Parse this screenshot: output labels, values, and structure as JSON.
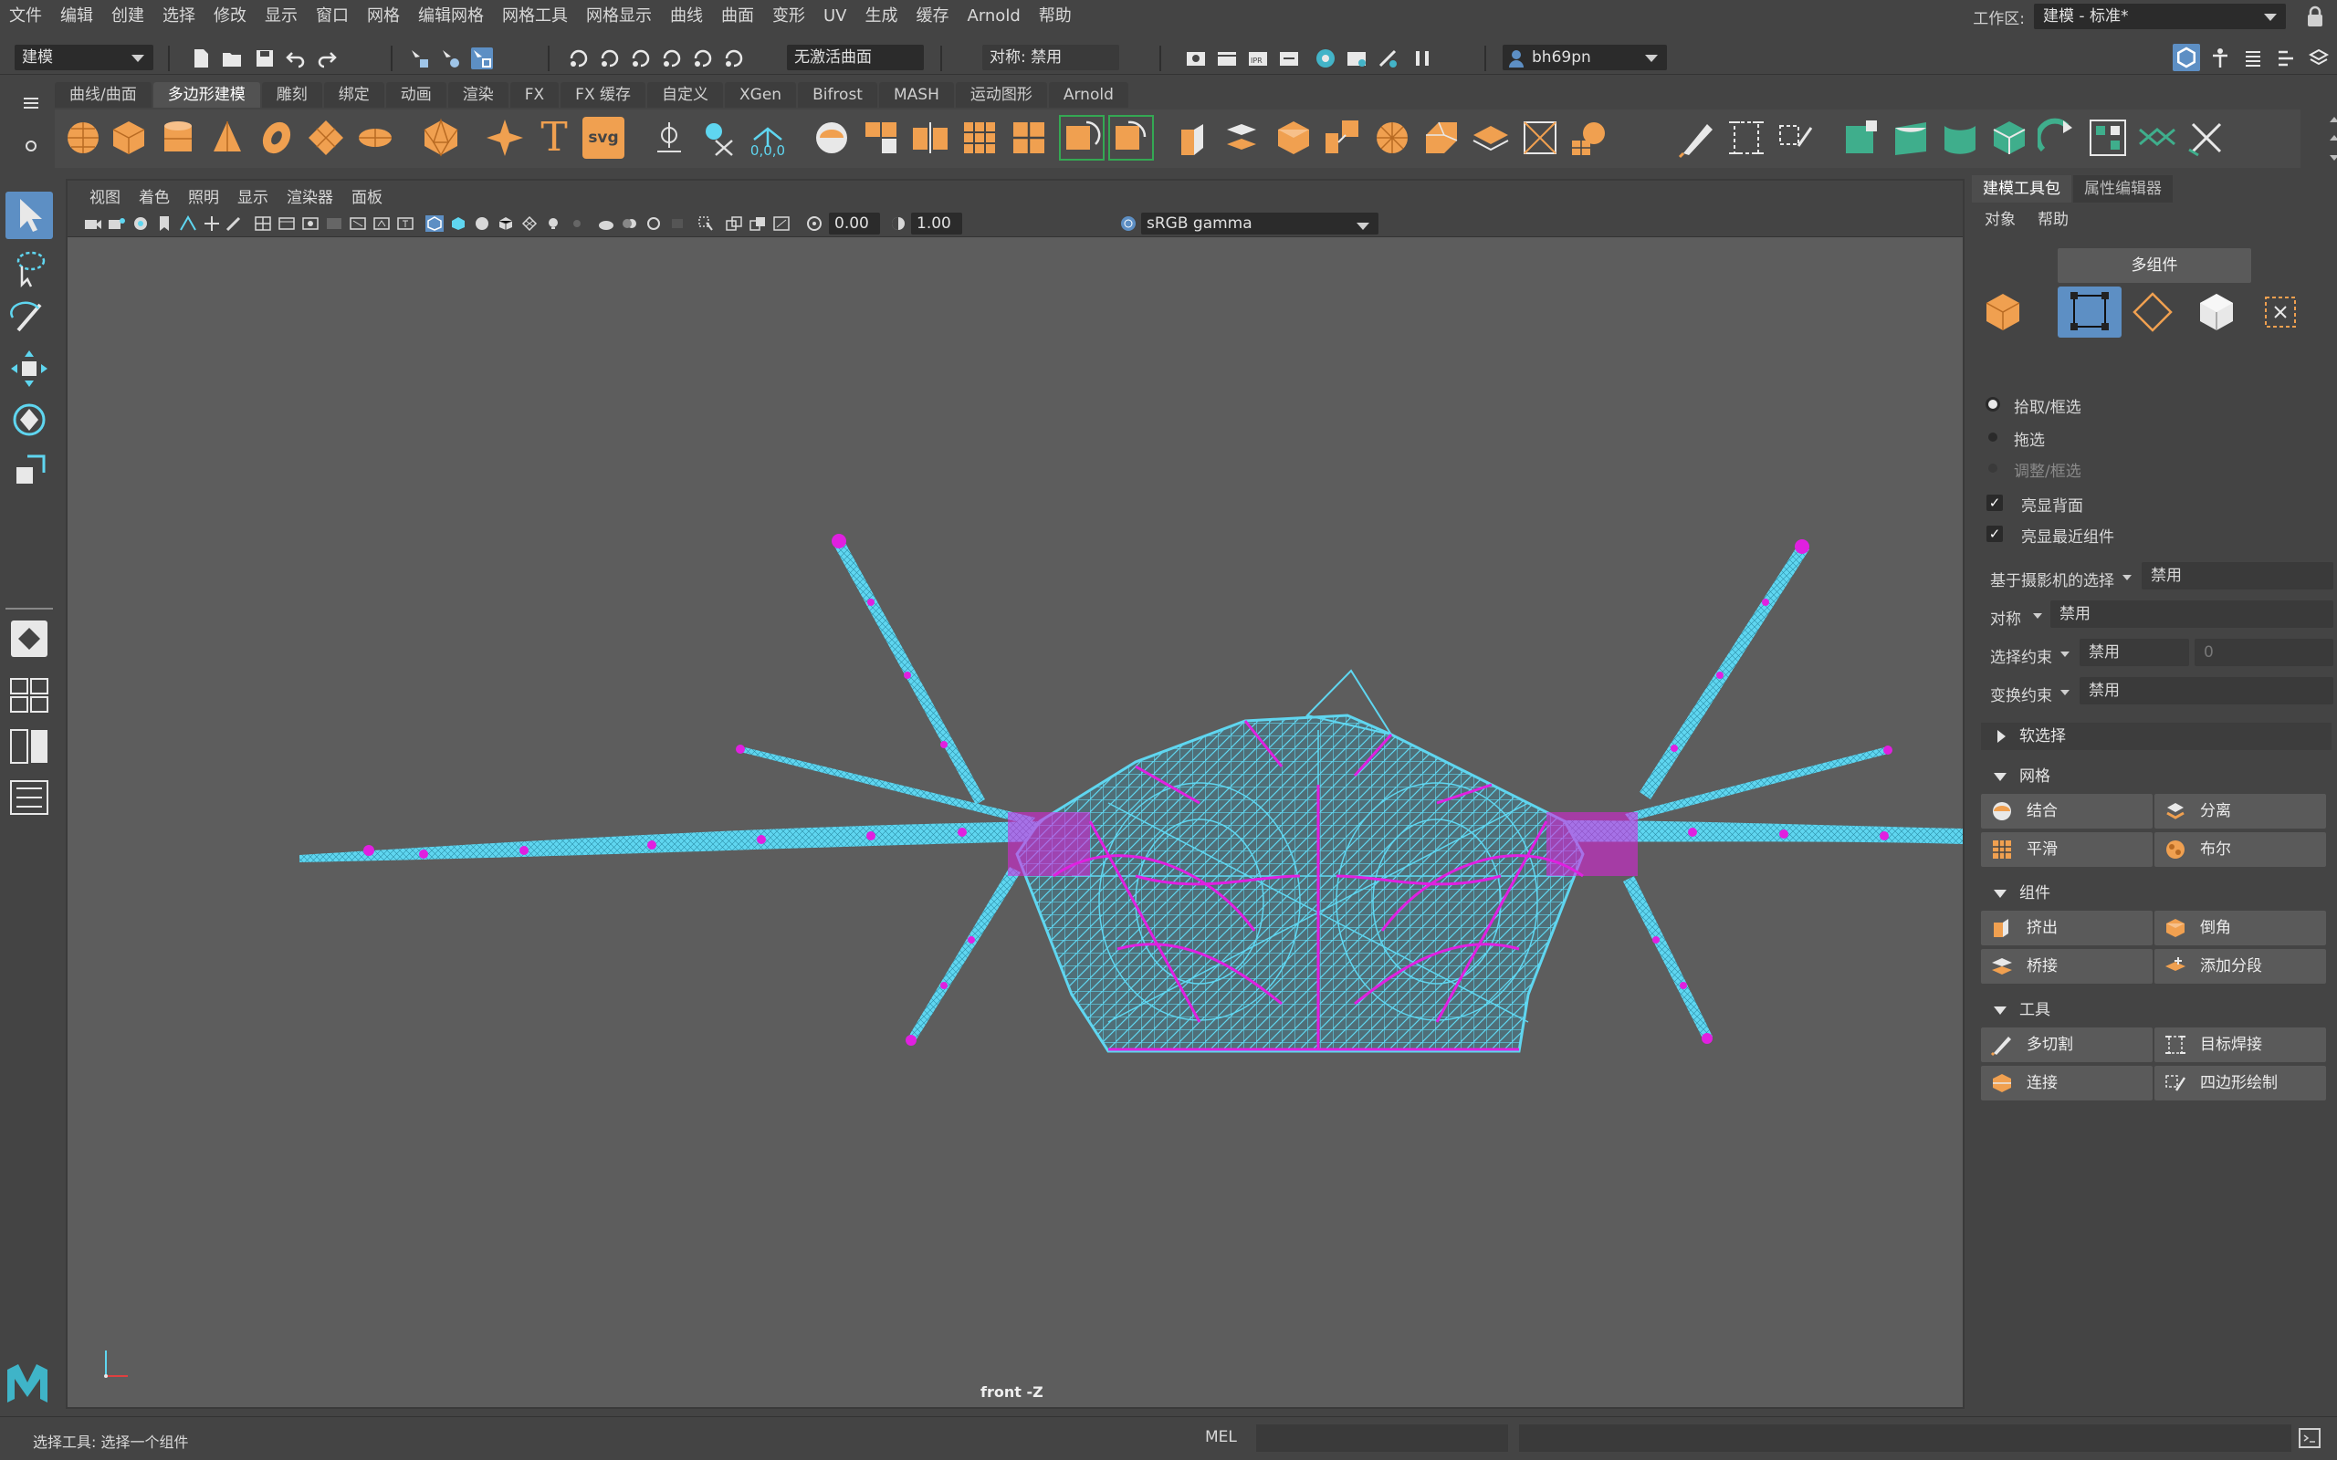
{
  "menu": [
    "文件",
    "编辑",
    "创建",
    "选择",
    "修改",
    "显示",
    "窗口",
    "网格",
    "编辑网格",
    "网格工具",
    "网格显示",
    "曲线",
    "曲面",
    "变形",
    "UV",
    "生成",
    "缓存",
    "Arnold",
    "帮助"
  ],
  "workspace": {
    "label": "工作区:",
    "value": "建模 - 标准*"
  },
  "statusline": {
    "mode": "建模",
    "live_surface": "无激活曲面",
    "symmetry": "对称: 禁用",
    "user": "bh69pn"
  },
  "shelf_tabs": [
    "曲线/曲面",
    "多边形建模",
    "雕刻",
    "绑定",
    "动画",
    "渲染",
    "FX",
    "FX 缓存",
    "自定义",
    "XGen",
    "Bifrost",
    "MASH",
    "运动图形",
    "Arnold"
  ],
  "shelf_active": "多边形建模",
  "shelf_text_icons": {
    "text": "T",
    "svg": "svg",
    "coords": "0,0,0"
  },
  "viewport": {
    "menu": [
      "视图",
      "着色",
      "照明",
      "显示",
      "渲染器",
      "面板"
    ],
    "exposure": "0.00",
    "gamma": "1.00",
    "colorspace": "sRGB gamma",
    "camera": "front -Z"
  },
  "panel": {
    "tabs": [
      "建模工具包",
      "属性编辑器"
    ],
    "menu": [
      "对象",
      "帮助"
    ],
    "multi_component": "多组件",
    "pick_marquee": "拾取/框选",
    "drag": "拖选",
    "tweak_marquee": "调整/框选",
    "highlight_backfaces": "亮显背面",
    "highlight_nearest": "亮显最近组件",
    "camera_based_label": "基于摄影机的选择",
    "camera_based_value": "禁用",
    "symmetry_label": "对称",
    "symmetry_value": "禁用",
    "sel_constraint_label": "选择约束",
    "sel_constraint_value": "禁用",
    "sel_constraint_num": "0",
    "xform_constraint_label": "变换约束",
    "xform_constraint_value": "禁用",
    "soft_select": "软选择",
    "mesh_section": "网格",
    "mesh_buttons": [
      "结合",
      "分离",
      "平滑",
      "布尔"
    ],
    "component_section": "组件",
    "component_buttons": [
      "挤出",
      "倒角",
      "桥接",
      "添加分段"
    ],
    "tools_section": "工具",
    "tools_buttons": [
      "多切割",
      "目标焊接",
      "连接",
      "四边形绘制"
    ]
  },
  "bottom": {
    "help": "选择工具: 选择一个组件",
    "lang": "MEL"
  },
  "colors": {
    "accent": "#5d8fc4",
    "wire": "#5fd6f0",
    "vertex": "#e020e0",
    "shelf_orange": "#f0a050"
  }
}
